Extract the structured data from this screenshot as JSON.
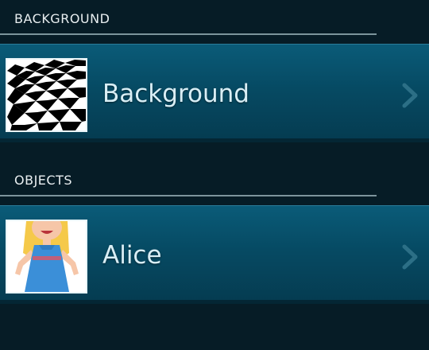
{
  "sections": {
    "background": {
      "header": "BACKGROUND",
      "item_label": "Background",
      "thumbnail_icon": "checkerboard-thumbnail"
    },
    "objects": {
      "header": "OBJECTS",
      "item_label": "Alice",
      "thumbnail_icon": "alice-character-thumbnail"
    }
  },
  "colors": {
    "page_background": "#061c26",
    "item_background": "#064a63",
    "header_text": "#e8eef0",
    "item_text": "#d9eef5",
    "chevron": "#2c6f86"
  }
}
